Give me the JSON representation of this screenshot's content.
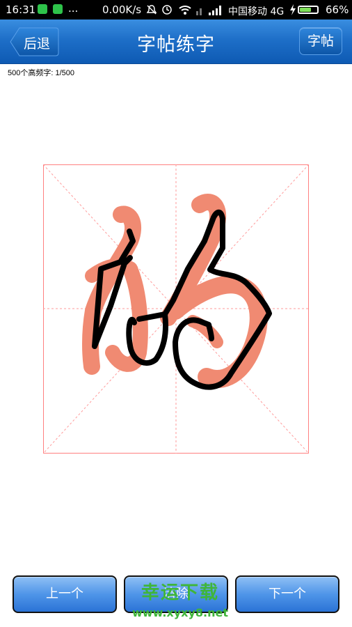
{
  "status_bar": {
    "time": "16:31",
    "overflow": "...",
    "net_speed": "0.00K/s",
    "carrier": "中国移动 4G",
    "battery_percent": "66%",
    "battery_level": 0.66,
    "icons": [
      "shield-app-icon",
      "app-icon",
      "mute-icon",
      "alarm-icon",
      "wifi-icon",
      "signal-icon",
      "charging-icon"
    ]
  },
  "header": {
    "back_label": "后退",
    "title": "字帖练字",
    "right_label": "字帖"
  },
  "progress_text": "500个高频字: 1/500",
  "practice": {
    "character": "的",
    "template_color": "#f08a72",
    "stroke_color": "#000000",
    "grid_color": "#ff8080"
  },
  "bottom_nav": {
    "prev_label": "上一个",
    "middle_label": "清除",
    "next_label": "下一个"
  },
  "watermark": {
    "line1": "幸运下载",
    "line2": "www.xyxy8.net"
  },
  "colors": {
    "header_blue": "#1e6fc8",
    "button_blue": "#4f95e8",
    "watermark_green": "#3fb53a"
  }
}
